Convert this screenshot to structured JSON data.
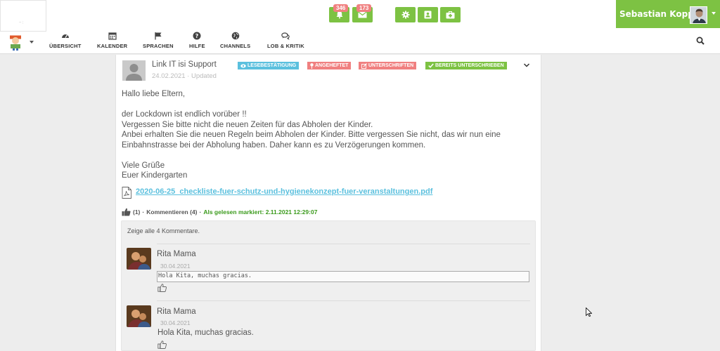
{
  "logo": {
    "text": "-- ;"
  },
  "header": {
    "notifications_count": "346",
    "messages_count": "173",
    "user_name": "Sebastian Kopp"
  },
  "nav": [
    {
      "label": "ÜBERSICHT",
      "icon": "dashboard-icon"
    },
    {
      "label": "KALENDER",
      "icon": "calendar-icon"
    },
    {
      "label": "SPRACHEN",
      "icon": "flag-icon"
    },
    {
      "label": "HILFE",
      "icon": "question-icon"
    },
    {
      "label": "CHANNELS",
      "icon": "globe-icon"
    },
    {
      "label": "LOB & KRITIK",
      "icon": "comments-icon"
    }
  ],
  "post": {
    "author": "Link IT isi Support",
    "date": "24.02.2021 · Updated",
    "tags": [
      {
        "label": "LESEBESTÄTIGUNG",
        "color": "#5bc0de",
        "icon": "eye-icon"
      },
      {
        "label": "ANGEHEFTET",
        "color": "#f08080",
        "icon": "pin-icon"
      },
      {
        "label": "UNTERSCHRIFTEN",
        "color": "#f08080",
        "icon": "edit-icon"
      },
      {
        "label": "BEREITS UNTERSCHRIEBEN",
        "color": "#7dc243",
        "icon": "check-icon"
      }
    ],
    "lines": [
      "Hallo liebe Eltern,",
      "der Lockdown ist endlich vorüber !!",
      "Vergessen Sie bitte nicht die neuen Zeiten für das Abholen der Kinder.",
      "Anbei erhalten Sie die neuen Regeln beim Abholen der Kinder. Bitte vergessen Sie nicht, das wir nun eine",
      "Einbahnstrasse bei der Abholung haben. Daher kann es zu Verzögerungen kommen.",
      "Viele Grüße",
      "Euer Kindergarten"
    ],
    "attachment": "2020-06-25_checkliste-fuer-schutz-und-hygienekonzept-fuer-veranstaltungen.pdf",
    "likes": "(1)",
    "comments_link": "Kommentieren (4)",
    "read_marked": "Als gelesen markiert: 2.11.2021 12:29:07"
  },
  "comments": {
    "show_all": "Zeige alle 4 Kommentare.",
    "items": [
      {
        "author": "Rita Mama",
        "date": "30.04.2021",
        "text": "Hola Kita, muchas gracias."
      },
      {
        "author": "Rita Mama",
        "date": "30.04.2021",
        "text": "Hola Kita, muchas gracias."
      }
    ]
  }
}
